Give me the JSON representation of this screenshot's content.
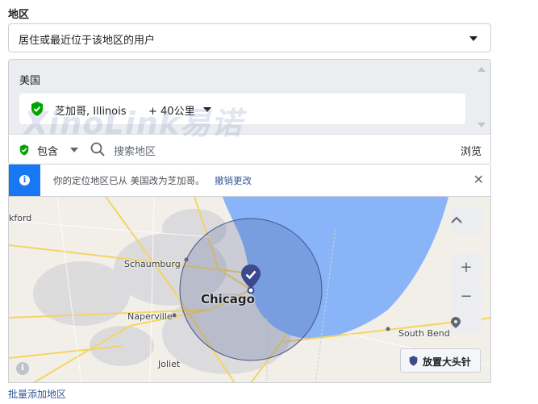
{
  "section": {
    "label": "地区"
  },
  "audience_select": {
    "value": "居住或最近位于该地区的用户"
  },
  "locations": {
    "country": "美国",
    "items": [
      {
        "name": "芝加哥, Illinois",
        "radius": "+ 40公里"
      }
    ]
  },
  "watermark": "XinoLink易诺",
  "toolbar": {
    "include_label": "包含",
    "search_placeholder": "搜索地区",
    "browse_label": "浏览"
  },
  "notice": {
    "message": "你的定位地区已从 美国改为芝加哥。",
    "undo_label": "撤销更改"
  },
  "map": {
    "labels": {
      "rockford": "kford",
      "schaumburg": "Schaumburg",
      "naperville": "Naperville",
      "chicago": "Chicago",
      "joliet": "Joliet",
      "south_bend": "South Bend"
    },
    "drop_pin_label": "放置大头针",
    "colors": {
      "lake": "#8ab4f8",
      "radius_fill": "rgba(66,82,140,0.22)",
      "radius_stroke": "#42528c",
      "pin": "#3b4a8c"
    }
  },
  "bulk_add": {
    "label": "批量添加地区"
  },
  "colors": {
    "include_green": "#00a400",
    "info_blue": "#1877f2",
    "link_blue": "#385898"
  },
  "icons": {
    "include": "green-shield-check-icon",
    "search": "magnifier-icon",
    "info": "info-icon",
    "close": "close-icon",
    "collapse": "chevron-up-icon",
    "zoom_in": "plus-icon",
    "zoom_out": "minus-icon",
    "locate": "pin-locate-icon",
    "drop_pin": "pin-icon"
  }
}
